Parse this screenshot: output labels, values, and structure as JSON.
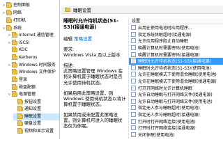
{
  "tree": {
    "items": [
      {
        "label": "控制面板",
        "arrow": ">",
        "indent": 0
      },
      {
        "label": "网络",
        "arrow": ">",
        "indent": 0
      },
      {
        "label": "打印机",
        "arrow": "",
        "indent": 0
      },
      {
        "label": "系统",
        "arrow": "v",
        "indent": 0
      },
      {
        "label": "Internet 通信管理",
        "arrow": ">",
        "indent": 1
      },
      {
        "label": "iSCSI",
        "arrow": ">",
        "indent": 1
      },
      {
        "label": "KDC",
        "arrow": "",
        "indent": 1
      },
      {
        "label": "Kerberos",
        "arrow": "",
        "indent": 1
      },
      {
        "label": "Windows 时间服务",
        "arrow": ">",
        "indent": 1
      },
      {
        "label": "Windows 文件保护",
        "arrow": "",
        "indent": 1
      },
      {
        "label": "登录",
        "arrow": "",
        "indent": 1
      },
      {
        "label": "磁盘配额",
        "arrow": "",
        "indent": 1
      },
      {
        "label": "电源管理",
        "arrow": "v",
        "indent": 1
      },
      {
        "label": "按钮设置",
        "arrow": "",
        "indent": 2
      },
      {
        "label": "通知设置",
        "arrow": "",
        "indent": 2
      },
      {
        "label": "睡眠设置",
        "arrow": "",
        "indent": 2
      },
      {
        "label": "硬盘设置",
        "arrow": "",
        "indent": 2
      },
      {
        "label": "视频和显示设置",
        "arrow": "",
        "indent": 2
      }
    ]
  },
  "header": {
    "title": "睡眠设置"
  },
  "description": {
    "title": "睡眠时允许待机状态(S1-S3)(接通电源)",
    "edit_label": "编辑",
    "edit_link": "策略设置",
    "req_label": "要求:",
    "req_value": "Windows Vista 及以上版本",
    "desc_label": "描述:",
    "desc_text": "此策略设置管理 Windows 在将计算机置于睡眠状态时是否允许使用待机状态。",
    "para2": "如果启用此策略设置，则 Windows 使用待机状态以将计算机置于睡眠状态。",
    "para3": "如果禁用或未配置此策略设置，则计算机可进入的睡眠状态仅为休眠。"
  },
  "list": {
    "header": "设置",
    "rows": [
      "启用在使用电池时应用程序...",
      "指定系统休眠超时(接通电源)",
      "允许应用程序阻止自动睡眠",
      "唤醒计算机时需要密码(使用电池)",
      "唤醒计算机时需要密码(接通电源)",
      "睡眠时允许待机状态(S1-S3)(接通电源)",
      "睡眠时允许待机状态(S1-S3)(使用电池)",
      "允许在睡眠模式下使用混合睡眠(使用电池)",
      "允许在睡眠模式下使用混合睡眠(接通电源)",
      "打开开网络时允许计算机睡眠",
      "允许自动睡眠与打开网络文件(接通电源)",
      "允许自动睡眠与打开网络文件(使用电池)",
      "指定无人参与睡眠超时(使用电池)",
      "指定无人参与睡眠超时(接通电源)",
      "打开时打开网络连接(使用电池)",
      "打开时打开网络连接(接通电源)",
      "关闭休眠(使用电池)"
    ],
    "selected_index": 5
  }
}
